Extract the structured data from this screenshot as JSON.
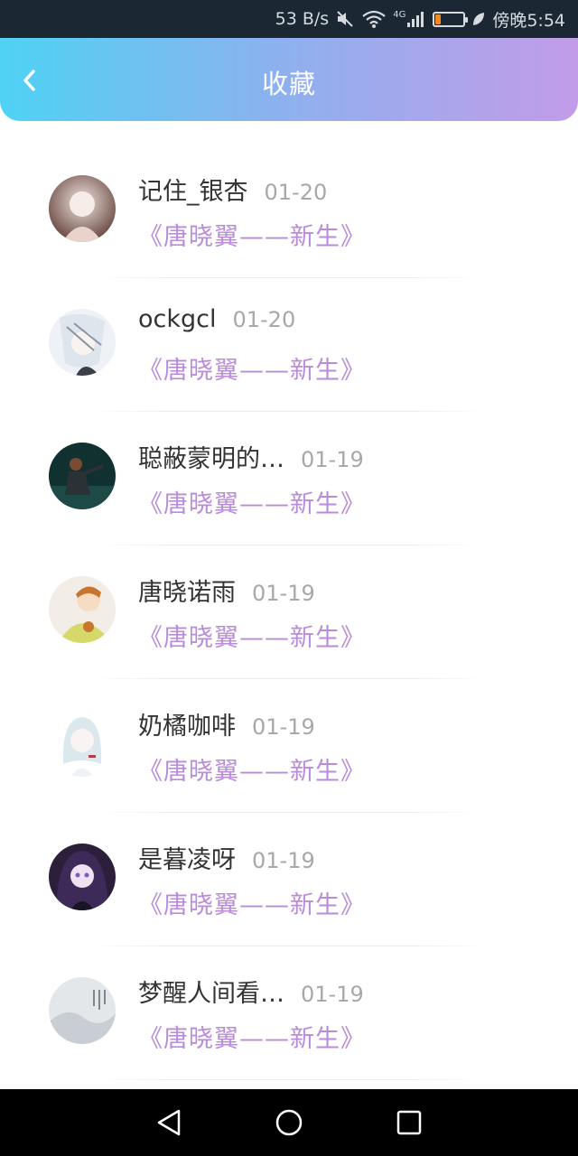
{
  "status_bar": {
    "net_speed": "53 B/s",
    "network_type": "4G",
    "battery": "18",
    "time": "傍晚5:54",
    "icons": [
      "mute-icon",
      "wifi-icon",
      "signal-icon",
      "battery-icon",
      "leaf-icon"
    ]
  },
  "header": {
    "title": "收藏",
    "back_icon": "chevron-left-icon"
  },
  "favorites": [
    {
      "name": "记住_银杏",
      "date": "01-20",
      "work": "《唐晓翼——新生》"
    },
    {
      "name": "ockgcl",
      "date": "01-20",
      "work": "《唐晓翼——新生》"
    },
    {
      "name": "聪蔽蒙明的…",
      "date": "01-19",
      "work": "《唐晓翼——新生》"
    },
    {
      "name": "唐晓诺雨",
      "date": "01-19",
      "work": "《唐晓翼——新生》"
    },
    {
      "name": "奶橘咖啡",
      "date": "01-19",
      "work": "《唐晓翼——新生》"
    },
    {
      "name": "是暮凌呀",
      "date": "01-19",
      "work": "《唐晓翼——新生》"
    },
    {
      "name": "梦醒人间看…",
      "date": "01-19",
      "work": "《唐晓翼——新生》"
    }
  ],
  "nav_bar": {
    "buttons": [
      "back-triangle-icon",
      "home-circle-icon",
      "recents-square-icon"
    ]
  },
  "colors": {
    "header_gradient_start": "#4fd2f4",
    "header_gradient_end": "#c29ce9",
    "work_title": "#b98bd9",
    "name": "#333333",
    "date": "#a8a8a8"
  }
}
